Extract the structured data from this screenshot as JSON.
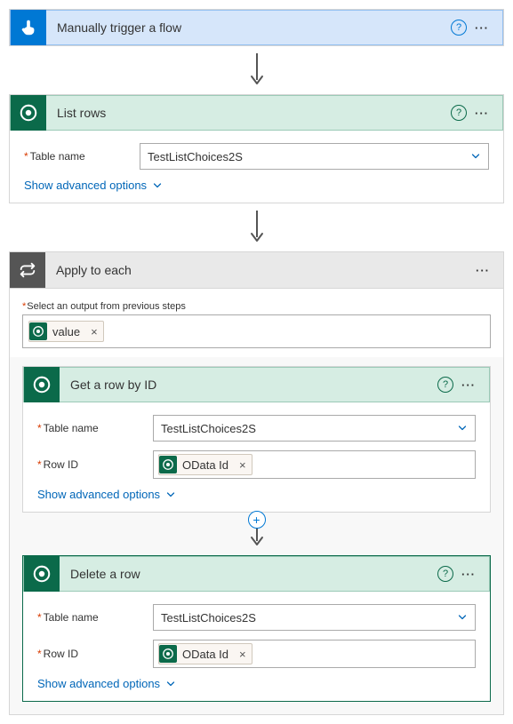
{
  "trigger": {
    "title": "Manually trigger a flow"
  },
  "listRows": {
    "title": "List rows",
    "tableLabel": "Table name",
    "tableValue": "TestListChoices2S",
    "advanced": "Show advanced options"
  },
  "applyEach": {
    "title": "Apply to each",
    "selectLabel": "Select an output from previous steps",
    "token": "value"
  },
  "getRow": {
    "title": "Get a row by ID",
    "tableLabel": "Table name",
    "tableValue": "TestListChoices2S",
    "rowIdLabel": "Row ID",
    "rowIdToken": "OData Id",
    "advanced": "Show advanced options"
  },
  "deleteRow": {
    "title": "Delete a row",
    "tableLabel": "Table name",
    "tableValue": "TestListChoices2S",
    "rowIdLabel": "Row ID",
    "rowIdToken": "OData Id",
    "advanced": "Show advanced options"
  }
}
